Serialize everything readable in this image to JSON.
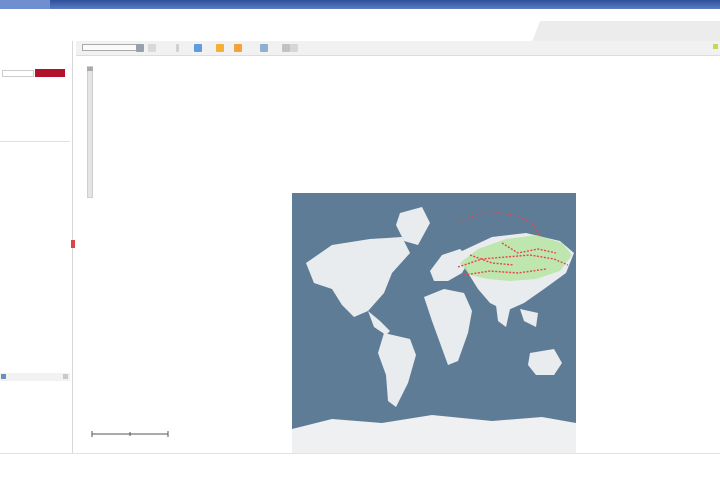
{
  "header": {
    "title": "",
    "right_line_1": "",
    "right_line_2": ""
  },
  "sidebar": {
    "line_1": "",
    "line_2": "",
    "button_label": "",
    "info_lines": [
      "",
      "",
      ""
    ]
  },
  "toolbar": {
    "base_layer_label": "",
    "legend_label": ""
  },
  "footer": {
    "text": "",
    "link_1": "",
    "link_2": ""
  },
  "colors": {
    "accent": "#b3122c",
    "ocean": "#5f7c97",
    "land": "#e9ecef",
    "highlight_route": "#e8474a",
    "highlight_area": "#b9e6a6"
  }
}
